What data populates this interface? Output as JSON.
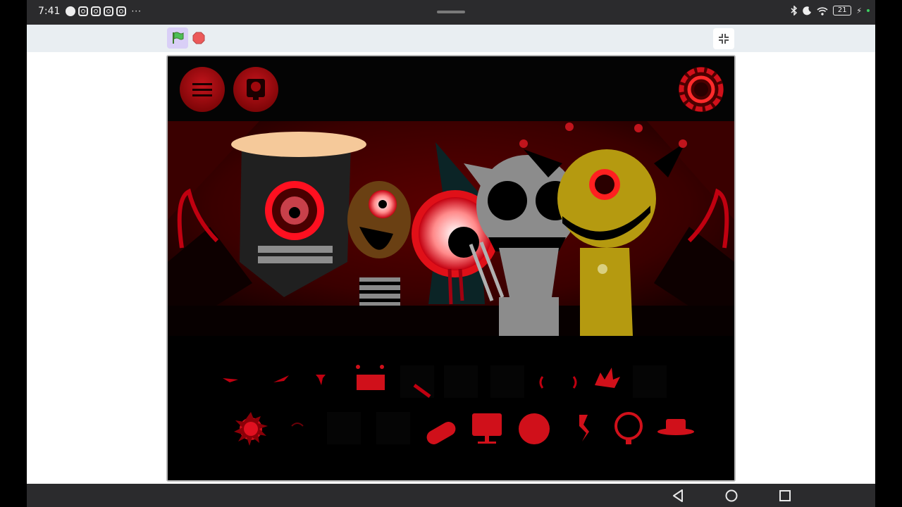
{
  "status_bar": {
    "time": "7:41",
    "notification_icons": [
      "messenger-icon",
      "instagram-icon",
      "instagram-icon",
      "instagram-icon",
      "instagram-icon"
    ],
    "more": "···",
    "battery_level": "21"
  },
  "toolbar": {
    "green_flag": "green-flag-icon",
    "stop": "stop-sign-icon",
    "fullscreen": "exit-fullscreen-icon"
  },
  "game": {
    "top_buttons": [
      "menu-icon",
      "character-icon"
    ],
    "reset_button": "reset-icon",
    "colors": {
      "accent_red": "#d0101a",
      "dark_red": "#7d0507",
      "backdrop": "#5a0000"
    },
    "performers": [
      "performer-black-box-head",
      "performer-brown-striped",
      "performer-red-eyeball",
      "performer-gray-cat",
      "performer-yellow-cyclops"
    ],
    "sound_icons_row1": [
      "sound-beat-1",
      "sound-beat-2",
      "sound-beat-3",
      "sound-beat-4",
      "sound-beat-5",
      "sound-beat-6",
      "sound-beat-7",
      "sound-beat-8",
      "sound-beat-9",
      "sound-beat-10"
    ],
    "sound_icons_row2": [
      "sound-melody-1",
      "sound-melody-2",
      "sound-melody-3",
      "sound-melody-4",
      "sound-melody-5",
      "sound-melody-6",
      "sound-melody-7",
      "sound-melody-8",
      "sound-melody-9",
      "sound-melody-10"
    ]
  },
  "nav_bar": {
    "buttons": [
      "back-icon",
      "home-icon",
      "recents-icon"
    ]
  }
}
